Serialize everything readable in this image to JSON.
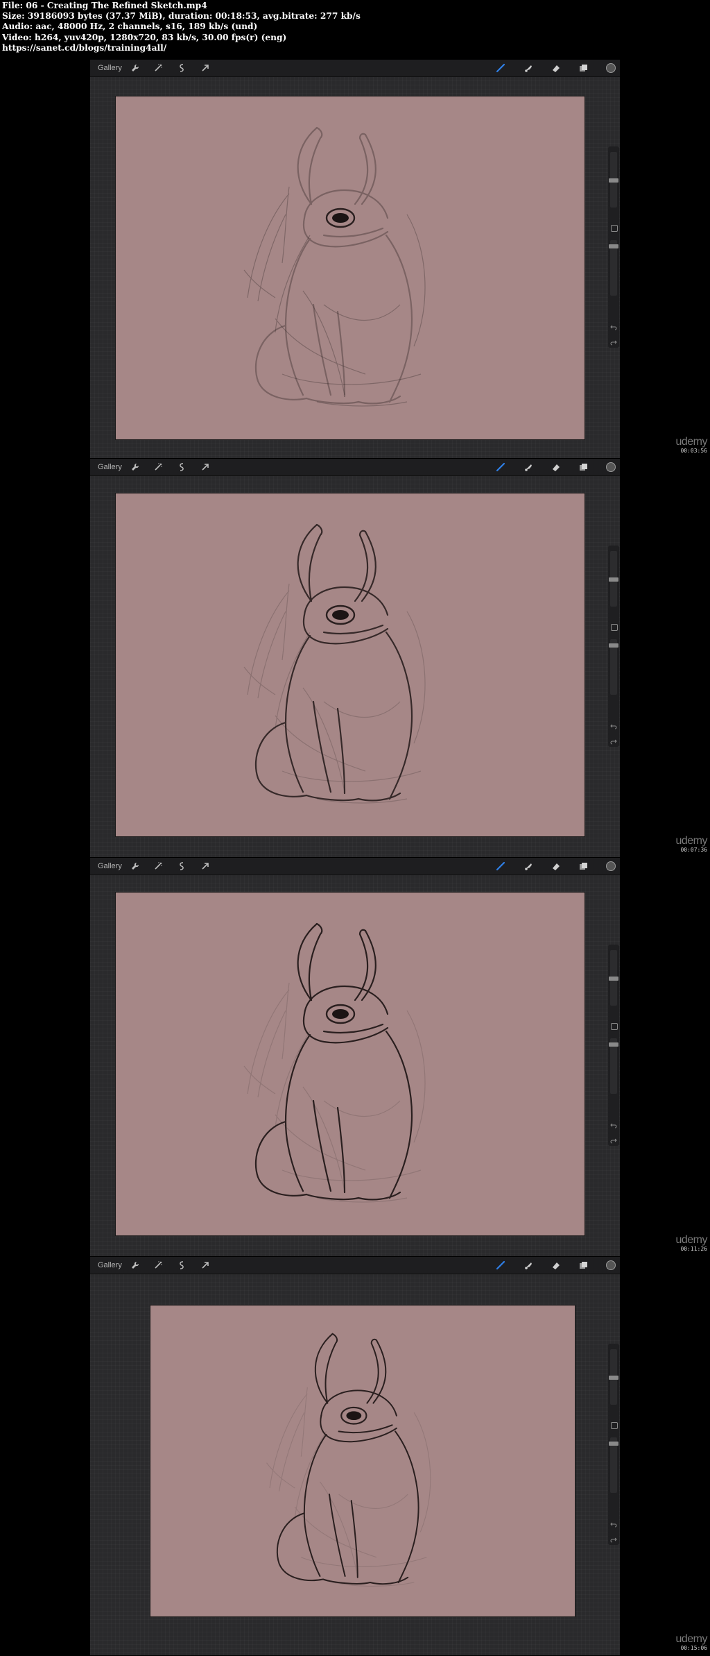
{
  "file_info": {
    "line1": "File: 06 - Creating The Refined Sketch.mp4",
    "line2": "Size: 39186093 bytes (37.37 MiB), duration: 00:18:53, avg.bitrate: 277 kb/s",
    "line3": "Audio: aac, 48000 Hz, 2 channels, s16, 189 kb/s (und)",
    "line4": "Video: h264, yuv420p, 1280x720, 83 kb/s, 30.00 fps(r) (eng)",
    "line5": "https://sanet.cd/blogs/training4all/"
  },
  "toolbar": {
    "gallery_label": "Gallery",
    "left_icons": [
      "wrench-icon",
      "magic-wand-icon",
      "selection-icon",
      "transform-arrow-icon"
    ],
    "right_icons": [
      "brush-icon",
      "smudge-icon",
      "eraser-icon",
      "layers-icon",
      "color-picker-icon"
    ],
    "accent_color": "#2f7fe6"
  },
  "canvas_color": "#a68787",
  "frames": [
    {
      "brand": "udemy",
      "timestamp": "00:03:56"
    },
    {
      "brand": "udemy",
      "timestamp": "00:07:36"
    },
    {
      "brand": "udemy",
      "timestamp": "00:11:26"
    },
    {
      "brand": "udemy",
      "timestamp": "00:15:06"
    }
  ]
}
